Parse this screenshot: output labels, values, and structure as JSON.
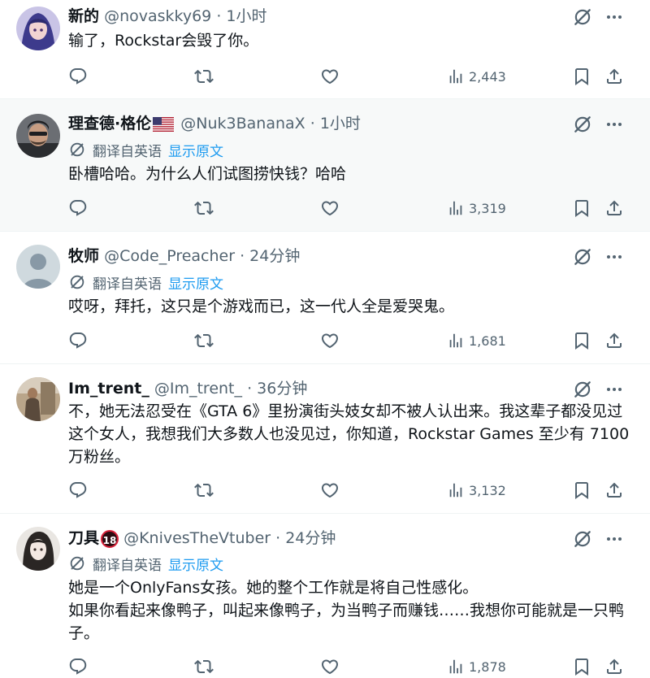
{
  "colors": {
    "link": "#1d9bf0",
    "muted": "#536471",
    "text": "#0f1419",
    "divider": "#eff3f4"
  },
  "translate": {
    "label": "翻译自英语",
    "show_original": "显示原文"
  },
  "tweets": [
    {
      "name": "新的",
      "handle": "@novaskky69",
      "time": "· 1小时",
      "text": "输了，Rockstar会毁了你。",
      "views": "2,443"
    },
    {
      "name": "理查德·格伦",
      "flag": "us-flag-icon",
      "handle": "@Nuk3BananaX",
      "time": "· 1小时",
      "translated": true,
      "text": "卧槽哈哈。为什么人们试图捞快钱？哈哈",
      "views": "3,319"
    },
    {
      "name": "牧师",
      "handle": "@Code_Preacher",
      "time": "· 24分钟",
      "translated": true,
      "text": "哎呀，拜托，这只是个游戏而已，这一代人全是爱哭鬼。",
      "views": "1,681"
    },
    {
      "name": "Im_trent_",
      "handle": "@Im_trent_",
      "time": "· 36分钟",
      "text": "不，她无法忍受在《GTA 6》里扮演街头妓女却不被人认出来。我这辈子都没见过这个女人，我想我们大多数人也没见过，你知道，Rockstar Games 至少有 7100 万粉丝。",
      "views": "3,132"
    },
    {
      "name": "刀具",
      "badge": "18",
      "handle": "@KnivesTheVtuber",
      "time": "· 24分钟",
      "translated": true,
      "text_line1": "她是一个OnlyFans女孩。她的整个工作就是将自己性感化。",
      "text_line2": "如果你看起来像鸭子，叫起来像鸭子，为当鸭子而赚钱……我想你可能就是一只鸭子。",
      "views": "1,878"
    }
  ]
}
